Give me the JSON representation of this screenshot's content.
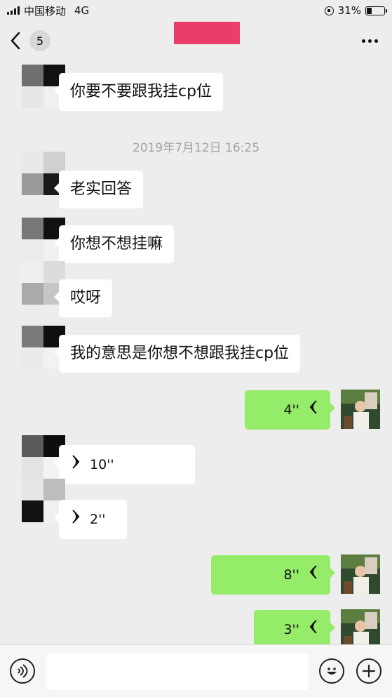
{
  "status_bar": {
    "carrier": "中国移动",
    "network": "4G",
    "battery_percent": "31%",
    "battery_level": 0.31
  },
  "nav": {
    "unread_count": "5",
    "title_redacted_color": "#ea3d6a"
  },
  "colors": {
    "incoming_bubble": "#ffffff",
    "outgoing_bubble": "#95ec69",
    "background": "#ededed"
  },
  "messages": [
    {
      "from": "them",
      "type": "text",
      "text": "你要不要跟我挂cp位"
    },
    {
      "type": "timestamp",
      "text": "2019年7月12日 16:25"
    },
    {
      "from": "them",
      "type": "text",
      "text": "老实回答"
    },
    {
      "from": "them",
      "type": "text",
      "text": "你想不想挂嘛"
    },
    {
      "from": "them",
      "type": "text",
      "text": "哎呀"
    },
    {
      "from": "them",
      "type": "text",
      "text": "我的意思是你想不想跟我挂cp位"
    },
    {
      "from": "me",
      "type": "voice",
      "duration": "4''"
    },
    {
      "from": "them",
      "type": "voice",
      "duration": "10''"
    },
    {
      "from": "them",
      "type": "voice",
      "duration": "2''"
    },
    {
      "from": "me",
      "type": "voice",
      "duration": "8''"
    },
    {
      "from": "me",
      "type": "voice",
      "duration": "3''"
    }
  ],
  "input": {
    "placeholder": ""
  },
  "icons": {
    "back": "chevron-left-icon",
    "more": "more-dots-icon",
    "voice_toggle": "voice-input-icon",
    "emoji": "emoji-icon",
    "plus": "plus-icon"
  }
}
